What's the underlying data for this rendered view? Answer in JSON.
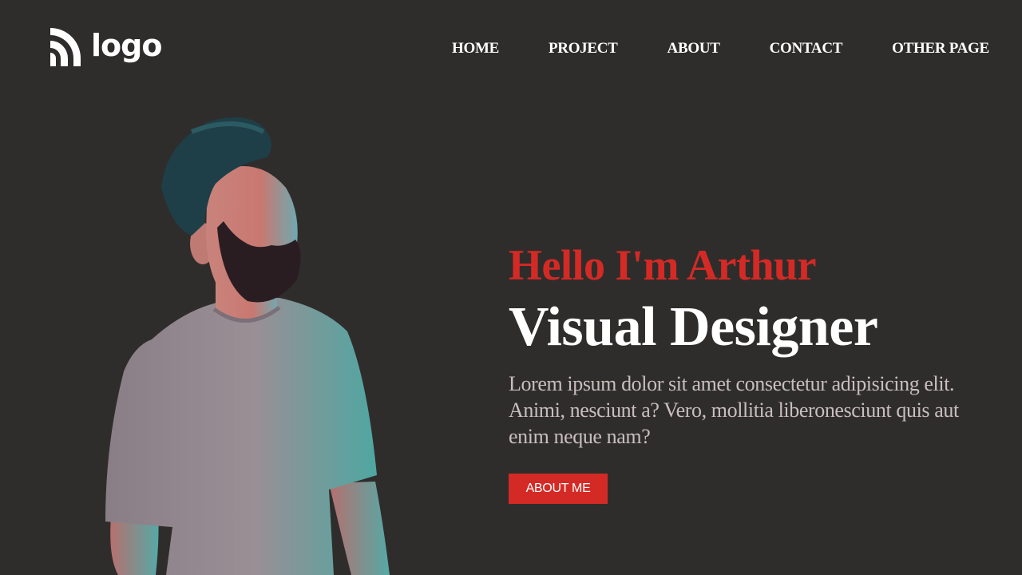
{
  "header": {
    "logo_text": "logo",
    "logo_icon": "wifi-signal-icon",
    "nav": [
      {
        "label": "HOME"
      },
      {
        "label": "PROJECT"
      },
      {
        "label": "ABOUT"
      },
      {
        "label": "CONTACT"
      },
      {
        "label": "OTHER PAGE"
      }
    ]
  },
  "hero": {
    "greeting": "Hello I'm Arthur",
    "role": "Visual Designer",
    "description": "Lorem ipsum dolor sit amet consectetur adipisicing elit. Animi, nesciunt a? Vero, mollitia liberonesciunt quis aut enim neque nam?",
    "button_label": "ABOUT ME"
  },
  "colors": {
    "background": "#2f2d2c",
    "accent": "#d42a25",
    "text_primary": "#ffffff",
    "text_muted": "#c9bfbd"
  }
}
